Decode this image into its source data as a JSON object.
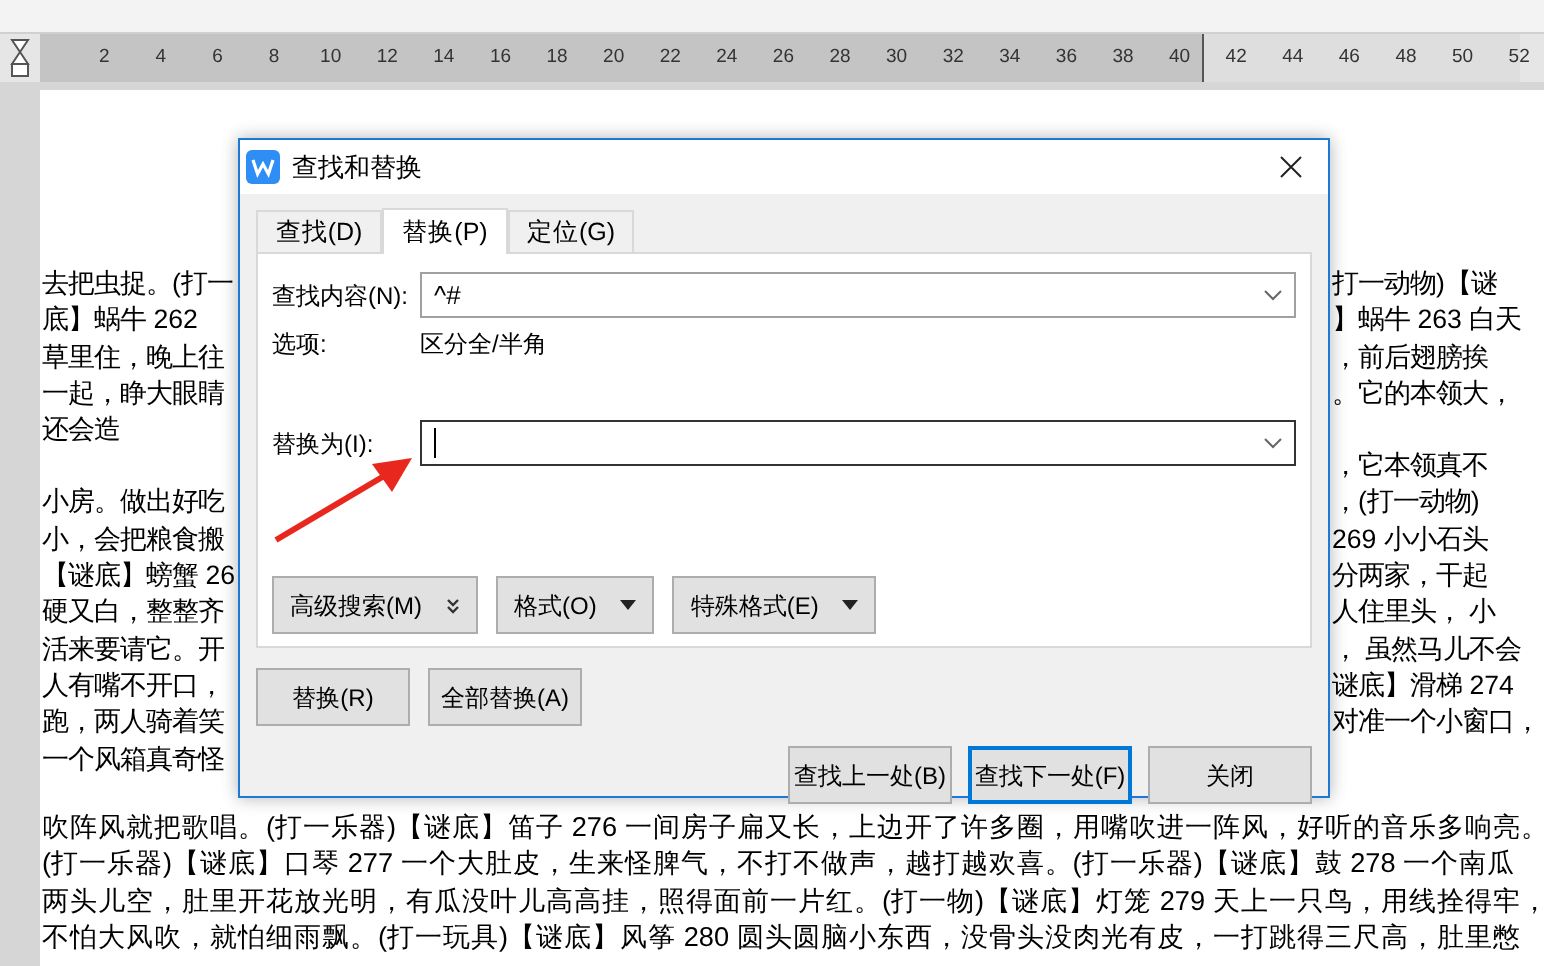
{
  "ruler": {
    "labels": [
      "2",
      "4",
      "6",
      "8",
      "10",
      "12",
      "14",
      "16",
      "18",
      "20",
      "22",
      "24",
      "26",
      "28",
      "30",
      "32",
      "34",
      "36",
      "38",
      "40",
      "42",
      "44",
      "46",
      "48",
      "50",
      "52"
    ]
  },
  "document": {
    "left_paragraphs": [
      [
        "去把虫捉。(打一",
        "底】蜗牛 262",
        "草里住，晚上往",
        "一起，睁大眼睛",
        "还会造"
      ],
      [
        "小房。做出好吃",
        "小，会把粮食搬",
        "【谜底】螃蟹 26",
        "硬又白，整整齐",
        "活来要请它。开",
        "人有嘴不开口，",
        "跑，两人骑着笑",
        "一个风箱真奇怪"
      ]
    ],
    "right_paragraphs": [
      [
        "打一动物)【谜",
        "】蜗牛 263  白天",
        "，前后翅膀挨",
        "。它的本领大，"
      ],
      [
        "，它本领真不",
        "，(打一动物)",
        "269  小小石头",
        "分两家，干起",
        "人住里头， 小",
        "， 虽然马儿不会",
        "谜底】滑梯 274",
        "对准一个小窗口，"
      ]
    ],
    "lines": [
      "吹阵风就把歌唱。(打一乐器)【谜底】笛子 276  一间房子扁又长，上边开了许多圈，用嘴吹进一阵风，好听的音乐多响亮。",
      "(打一乐器)【谜底】口琴 277  一个大肚皮，生来怪脾气，不打不做声，越打越欢喜。(打一乐器)【谜底】鼓 278  一个南瓜",
      "两头儿空，肚里开花放光明，有瓜没叶儿高高挂，照得面前一片红。(打一物)【谜底】灯笼 279  天上一只鸟，用线拴得牢，",
      "不怕大风吹，就怕细雨飘。(打一玩具)【谜底】风筝 280  圆头圆脑小东西，没骨头没肉光有皮，一打跳得三尺高，肚里憋"
    ]
  },
  "dialog": {
    "title": "查找和替换",
    "tabs": [
      {
        "label": "查找(D)",
        "selected": false
      },
      {
        "label": "替换(P)",
        "selected": true
      },
      {
        "label": "定位(G)",
        "selected": false
      }
    ],
    "find": {
      "label": "查找内容(N):",
      "value": "^#",
      "focused": false
    },
    "options": {
      "label": "选项:",
      "value": "区分全/半角"
    },
    "replace": {
      "label": "替换为(I):",
      "focused": true
    },
    "panel_buttons": [
      {
        "label": "高级搜索(M)",
        "kind": "expand"
      },
      {
        "label": "格式(O)",
        "kind": "menu"
      },
      {
        "label": "特殊格式(E)",
        "kind": "menu"
      }
    ],
    "replace_buttons": [
      "替换(R)",
      "全部替换(A)"
    ],
    "nav_buttons": [
      {
        "label": "查找上一处(B)",
        "default": false
      },
      {
        "label": "查找下一处(F)",
        "default": true
      },
      {
        "label": "关闭",
        "default": false
      }
    ]
  }
}
